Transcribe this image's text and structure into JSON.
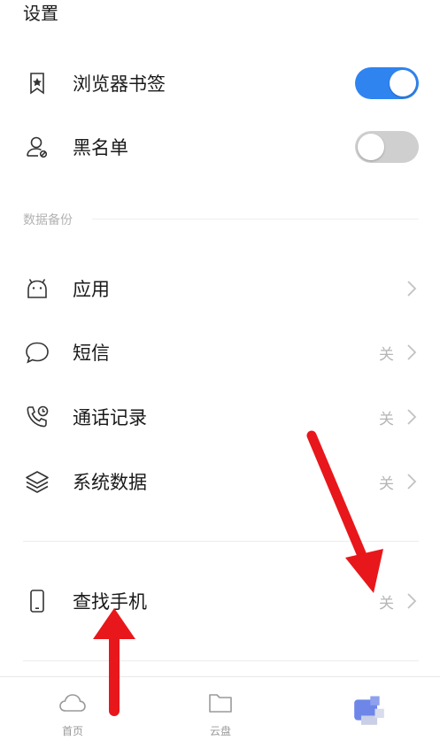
{
  "header": {
    "title": "设置"
  },
  "toggles": [
    {
      "label": "浏览器书签",
      "icon": "bookmark-icon",
      "state": "on"
    },
    {
      "label": "黑名单",
      "icon": "user-block-icon",
      "state": "off"
    }
  ],
  "backup": {
    "section_title": "数据备份",
    "items": [
      {
        "label": "应用",
        "icon": "android-icon",
        "status": ""
      },
      {
        "label": "短信",
        "icon": "message-icon",
        "status": "关"
      },
      {
        "label": "通话记录",
        "icon": "call-log-icon",
        "status": "关"
      },
      {
        "label": "系统数据",
        "icon": "layers-icon",
        "status": "关"
      }
    ]
  },
  "find_phone": {
    "label": "查找手机",
    "icon": "phone-icon",
    "status": "关"
  },
  "tabbar": {
    "tabs": [
      {
        "label": "首页",
        "icon": "cloud-icon"
      },
      {
        "label": "云盘",
        "icon": "folder-icon"
      }
    ]
  },
  "colors": {
    "toggle_on": "#2f84f0",
    "toggle_off": "#cfcfcf",
    "arrow": "#e8171b"
  }
}
